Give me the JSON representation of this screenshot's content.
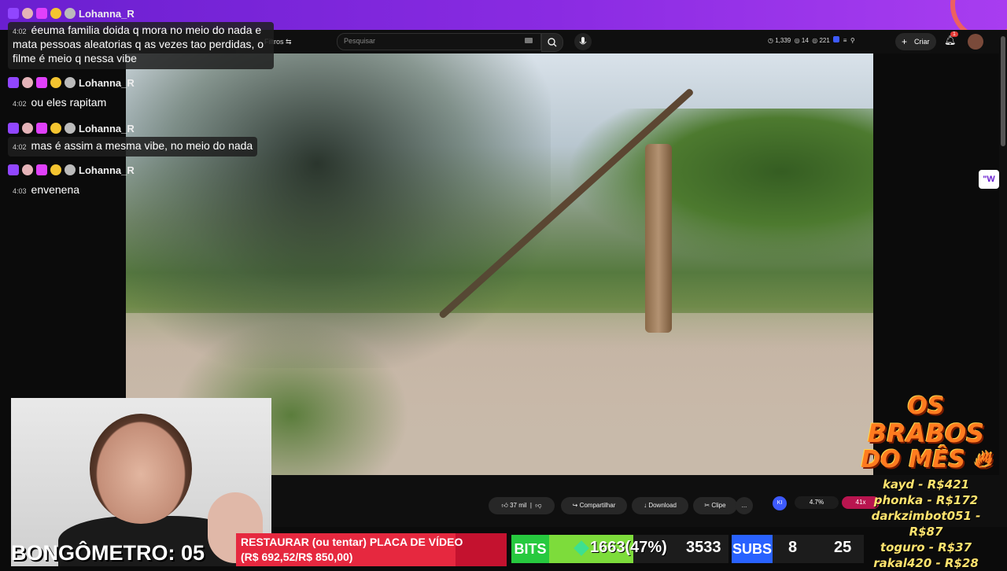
{
  "youtube": {
    "filters_label": "Filtros",
    "search_placeholder": "Pesquisar",
    "stats": {
      "views": "1,339",
      "comments": "14",
      "likes": "221"
    },
    "create_label": "Criar",
    "notif_count": "1",
    "actions": {
      "likes": "37 mil",
      "share": "Compartilhar",
      "download": "Download",
      "clip": "Clipe",
      "more": "..."
    },
    "meter": {
      "left": "4.7%",
      "right": "41x",
      "badge": "KI",
      "fill_pct": 47
    }
  },
  "chat": [
    {
      "user": "Lohanna_R",
      "time": "4:02",
      "text": "éeuma familia doida q mora no meio do nada e mata pessoas aleatorias q as vezes tao perdidas, o filme é meio q nessa vibe"
    },
    {
      "user": "Lohanna_R",
      "time": "4:02",
      "text": "ou eles rapitam"
    },
    {
      "user": "Lohanna_R",
      "time": "4:02",
      "text": "mas é assim a mesma vibe, no meio do nada"
    },
    {
      "user": "Lohanna_R",
      "time": "4:03",
      "text": "envenena"
    }
  ],
  "overlay": {
    "bongometro": "BONGÔMETRO: 05",
    "goal_line1": "RESTAURAR (ou tentar) PLACA DE VÍDEO",
    "goal_line2": "(R$ 692,52/R$ 850,00)",
    "goal_pct": 81,
    "bits_label": "BITS",
    "bits_value": "1663(47%)",
    "bits_goal": "3533",
    "bits_pct": 47,
    "subs_label": "SUBS",
    "subs_value": "8",
    "subs_goal": "25",
    "brabos": [
      "OS",
      "BRABOS",
      "DO MÊS"
    ],
    "donors": [
      "kayd - R$421",
      "phonka - R$172",
      "darkzimbot051 - R$87",
      "toguro - R$37",
      "rakal420 - R$28"
    ]
  },
  "colors": {
    "twitch": "#9146ff",
    "accent": "#8a2be2",
    "goal": "#c4122f",
    "bits": "#27c93f",
    "subs": "#2962ff"
  }
}
